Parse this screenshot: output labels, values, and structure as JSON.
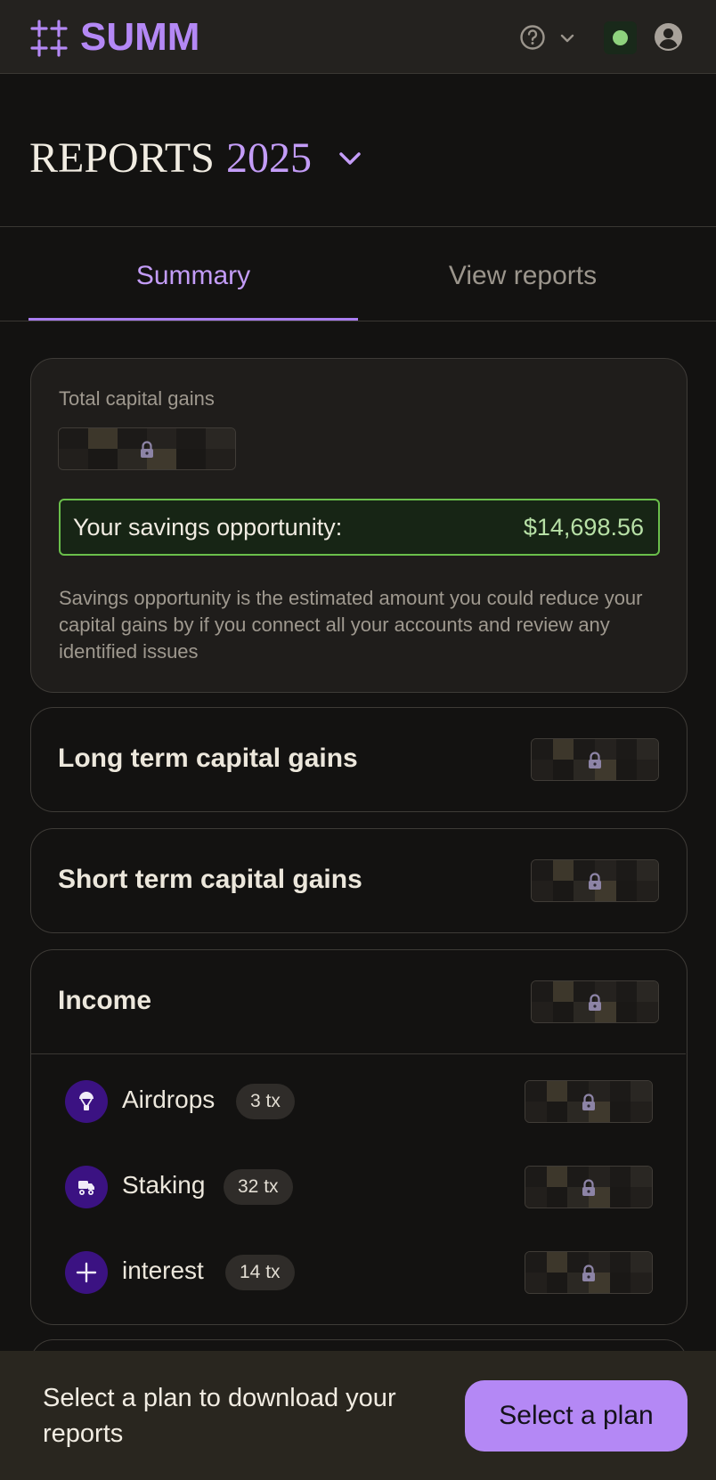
{
  "header": {
    "logo_text": "SUMM",
    "help_icon": "question-circle-icon",
    "dropdown_icon": "chevron-down-icon",
    "status_color": "#8fd27e",
    "account_icon": "user-circle-icon"
  },
  "page": {
    "title": "REPORTS",
    "year": "2025"
  },
  "tabs": [
    {
      "label": "Summary",
      "active": true
    },
    {
      "label": "View reports",
      "active": false
    }
  ],
  "summary": {
    "total_label": "Total capital gains",
    "savings_label": "Your savings opportunity:",
    "savings_value": "$14,698.56",
    "savings_note": "Savings opportunity is the estimated amount you could reduce your capital gains by if you connect all your accounts and review any identified issues"
  },
  "sections": {
    "long_term": "Long term capital gains",
    "short_term": "Short term capital gains",
    "income": "Income"
  },
  "income_items": [
    {
      "label": "Airdrops",
      "count": "3 tx",
      "icon": "airdrop-icon"
    },
    {
      "label": "Staking",
      "count": "32 tx",
      "icon": "staking-icon"
    },
    {
      "label": "interest",
      "count": "14 tx",
      "icon": "plus-icon"
    }
  ],
  "footer": {
    "message": "Select a plan to download your reports",
    "button_label": "Select a plan"
  },
  "colors": {
    "accent": "#b488f5",
    "savings_border": "#6abf4b",
    "background": "#131211"
  }
}
